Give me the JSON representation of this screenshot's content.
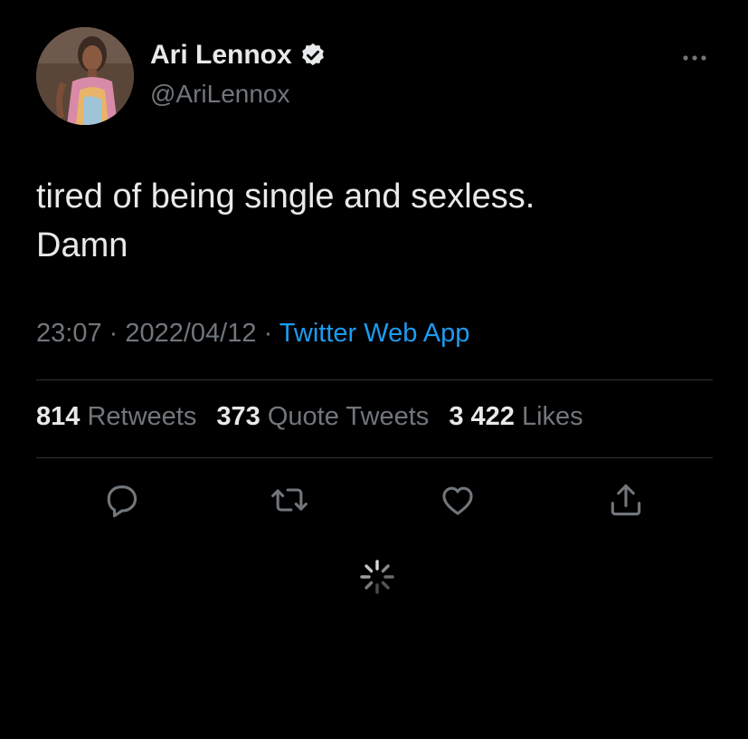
{
  "author": {
    "display_name": "Ari Lennox",
    "handle": "@AriLennox",
    "verified_icon": "verified-badge-icon",
    "avatar_icon": "profile-photo"
  },
  "tweet": {
    "text": "tired of being single and sexless.\nDamn",
    "time": "23:07",
    "date": "2022/04/12",
    "separator": " · ",
    "source": "Twitter Web App"
  },
  "stats": {
    "retweets_count": "814",
    "retweets_label": "Retweets",
    "quotes_count": "373",
    "quotes_label": "Quote Tweets",
    "likes_count": "3 422",
    "likes_label": "Likes"
  },
  "actions": [
    {
      "name": "reply",
      "icon": "reply-icon"
    },
    {
      "name": "retweet",
      "icon": "retweet-icon"
    },
    {
      "name": "like",
      "icon": "heart-icon"
    },
    {
      "name": "share",
      "icon": "share-icon"
    }
  ],
  "colors": {
    "background": "#000000",
    "text_primary": "#e7e9ea",
    "text_secondary": "#71767b",
    "accent": "#1d9bf0",
    "divider": "#2f3336"
  }
}
